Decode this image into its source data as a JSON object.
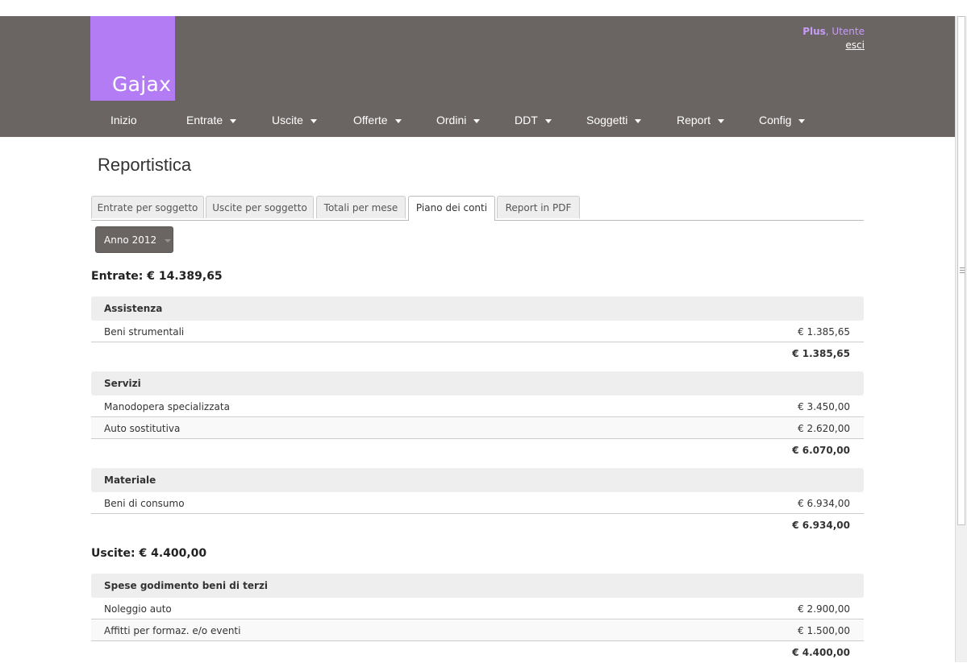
{
  "app": {
    "logo_text": "Gajax",
    "user_plan": "Plus",
    "user_name": ", Utente",
    "logout_label": "esci"
  },
  "nav": [
    {
      "label": "Inizio",
      "dropdown": false
    },
    {
      "label": "Entrate",
      "dropdown": true
    },
    {
      "label": "Uscite",
      "dropdown": true
    },
    {
      "label": "Offerte",
      "dropdown": true
    },
    {
      "label": "Ordini",
      "dropdown": true
    },
    {
      "label": "DDT",
      "dropdown": true
    },
    {
      "label": "Soggetti",
      "dropdown": true
    },
    {
      "label": "Report",
      "dropdown": true
    },
    {
      "label": "Config",
      "dropdown": true
    }
  ],
  "page": {
    "title": "Reportistica",
    "tabs": [
      {
        "label": "Entrate per soggetto",
        "active": false
      },
      {
        "label": "Uscite per soggetto",
        "active": false
      },
      {
        "label": "Totali per mese",
        "active": false
      },
      {
        "label": "Piano dei conti",
        "active": true
      },
      {
        "label": "Report in PDF",
        "active": false
      }
    ],
    "year_selector": "Anno 2012"
  },
  "income": {
    "heading": "Entrate: € 14.389,65",
    "groups": [
      {
        "name": "Assistenza",
        "rows": [
          {
            "label": "Beni strumentali",
            "amount": "€ 1.385,65"
          }
        ],
        "total": "€ 1.385,65"
      },
      {
        "name": "Servizi",
        "rows": [
          {
            "label": "Manodopera specializzata",
            "amount": "€ 3.450,00"
          },
          {
            "label": "Auto sostitutiva",
            "amount": "€ 2.620,00"
          }
        ],
        "total": "€ 6.070,00"
      },
      {
        "name": "Materiale",
        "rows": [
          {
            "label": "Beni di consumo",
            "amount": "€ 6.934,00"
          }
        ],
        "total": "€ 6.934,00"
      }
    ]
  },
  "expenses": {
    "heading": "Uscite: € 4.400,00",
    "groups": [
      {
        "name": "Spese godimento beni di terzi",
        "rows": [
          {
            "label": "Noleggio auto",
            "amount": "€ 2.900,00"
          },
          {
            "label": "Affitti per formaz. e/o eventi",
            "amount": "€ 1.500,00"
          }
        ],
        "total": "€ 4.400,00"
      }
    ]
  },
  "colors": {
    "header_bg": "#6a6463",
    "logo_bg": "#b47cf4",
    "user_accent": "#c79cf7"
  }
}
